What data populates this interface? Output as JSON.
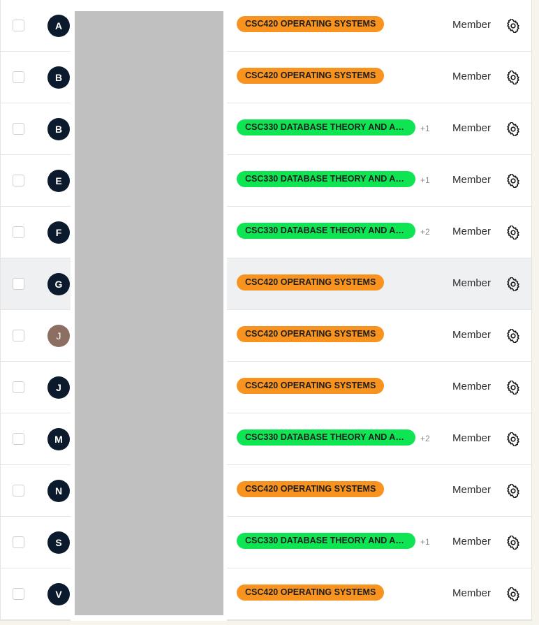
{
  "members": [
    {
      "initial": "A",
      "avatar_style": "dark",
      "course": "CSC420 OPERATING SYSTEMS",
      "course_color": "orange",
      "extra": "",
      "role": "Member"
    },
    {
      "initial": "B",
      "avatar_style": "dark",
      "course": "CSC420 OPERATING SYSTEMS",
      "course_color": "orange",
      "extra": "",
      "role": "Member"
    },
    {
      "initial": "B",
      "avatar_style": "dark",
      "course": "CSC330 DATABASE THEORY AND APP…",
      "course_color": "green",
      "extra": "+1",
      "role": "Member"
    },
    {
      "initial": "E",
      "avatar_style": "dark",
      "course": "CSC330 DATABASE THEORY AND APP…",
      "course_color": "green",
      "extra": "+1",
      "role": "Member"
    },
    {
      "initial": "F",
      "avatar_style": "dark",
      "course": "CSC330 DATABASE THEORY AND APP…",
      "course_color": "green",
      "extra": "+2",
      "role": "Member"
    },
    {
      "initial": "G",
      "avatar_style": "dark",
      "course": "CSC420 OPERATING SYSTEMS",
      "course_color": "orange",
      "extra": "",
      "role": "Member",
      "highlighted": true
    },
    {
      "initial": "J",
      "avatar_style": "photo",
      "course": "CSC420 OPERATING SYSTEMS",
      "course_color": "orange",
      "extra": "",
      "role": "Member"
    },
    {
      "initial": "J",
      "avatar_style": "dark",
      "course": "CSC420 OPERATING SYSTEMS",
      "course_color": "orange",
      "extra": "",
      "role": "Member"
    },
    {
      "initial": "M",
      "avatar_style": "dark",
      "course": "CSC330 DATABASE THEORY AND APP…",
      "course_color": "green",
      "extra": "+2",
      "role": "Member"
    },
    {
      "initial": "N",
      "avatar_style": "dark",
      "course": "CSC420 OPERATING SYSTEMS",
      "course_color": "orange",
      "extra": "",
      "role": "Member"
    },
    {
      "initial": "S",
      "avatar_style": "dark",
      "course": "CSC330 DATABASE THEORY AND APP…",
      "course_color": "green",
      "extra": "+1",
      "role": "Member"
    },
    {
      "initial": "V",
      "avatar_style": "dark",
      "course": "CSC420 OPERATING SYSTEMS",
      "course_color": "orange",
      "extra": "",
      "role": "Member"
    }
  ],
  "icons": {
    "settings": "gear-icon"
  },
  "colors": {
    "orange_tag": "#f7931e",
    "green_tag": "#0fe552",
    "avatar_dark": "#0b1a2c",
    "highlight_row": "#eff0f2",
    "redaction": "#c0c0c0"
  }
}
